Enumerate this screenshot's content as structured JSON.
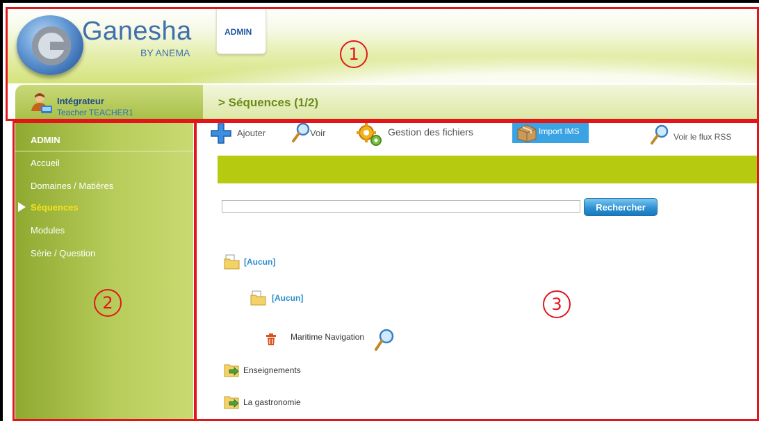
{
  "header": {
    "logo_name": "Ganesha",
    "logo_sub": "BY ANEMA",
    "tab_label": "ADMIN"
  },
  "user": {
    "role": "Intégrateur",
    "name": "Teacher TEACHER1"
  },
  "page_heading": "> Séquences (1/2)",
  "sidebar": {
    "section": "ADMIN",
    "items": [
      {
        "label": "Accueil"
      },
      {
        "label": "Domaines / Matières"
      },
      {
        "label": "Séquences"
      },
      {
        "label": "Modules"
      },
      {
        "label": "Série / Question"
      }
    ]
  },
  "toolbar": {
    "add": "Ajouter",
    "view": "Voir",
    "files": "Gestion des fichiers",
    "import": "Import IMS",
    "rss": "Voir le flux RSS"
  },
  "search": {
    "value": "",
    "button": "Rechercher"
  },
  "tree": [
    {
      "label": "[Aucun]"
    },
    {
      "label": "[Aucun]"
    },
    {
      "label": "Maritime Navigation"
    },
    {
      "label": "Enseignements"
    },
    {
      "label": "La gastronomie"
    }
  ],
  "annotations": [
    "1",
    "2",
    "3"
  ],
  "colors": {
    "annotation_red": "#e0161b",
    "band_green": "#b6ca0f",
    "link_blue": "#2a8fcc",
    "active_yellow": "#f4e11a"
  }
}
